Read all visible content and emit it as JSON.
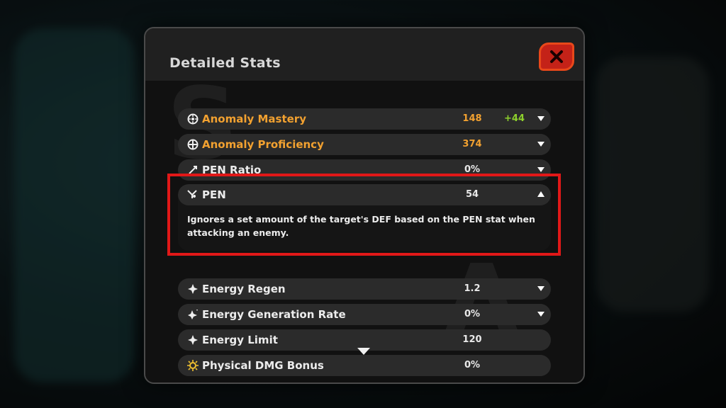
{
  "modal": {
    "title": "Detailed Stats",
    "close_icon": "close-x-icon"
  },
  "stats": [
    {
      "label": "Anomaly Mastery",
      "value": "148",
      "bonus": "+44",
      "icon": "anomaly-mastery-icon",
      "highlight_color": "#f2a130",
      "expanded": false
    },
    {
      "label": "Anomaly Proficiency",
      "value": "374",
      "icon": "anomaly-proficiency-icon",
      "highlight_color": "#f2a130",
      "expanded": false
    },
    {
      "label": "PEN Ratio",
      "value": "0%",
      "icon": "pen-ratio-icon",
      "expanded": false
    },
    {
      "label": "PEN",
      "value": "54",
      "icon": "pen-icon",
      "expanded": true,
      "description": "Ignores a set amount of the target's DEF based on the PEN stat when attacking an enemy."
    },
    {
      "label": "Energy Regen",
      "value": "1.2",
      "icon": "energy-regen-icon",
      "expanded": false
    },
    {
      "label": "Energy Generation Rate",
      "value": "0%",
      "icon": "energy-generation-icon",
      "expanded": false
    },
    {
      "label": "Energy Limit",
      "value": "120",
      "icon": "energy-limit-icon",
      "expanded": false
    },
    {
      "label": "Physical DMG Bonus",
      "value": "0%",
      "icon": "physical-dmg-icon",
      "expanded": false
    }
  ],
  "colors": {
    "accent_orange": "#f2a130",
    "bonus_green": "#8ed12c",
    "close_red": "#c42218",
    "highlight_red": "#e11818"
  }
}
